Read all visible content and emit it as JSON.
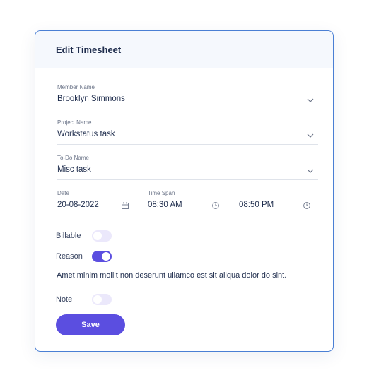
{
  "dialog": {
    "title": "Edit Timesheet",
    "member": {
      "label": "Member Name",
      "value": "Brooklyn Simmons"
    },
    "project": {
      "label": "Project Name",
      "value": "Workstatus task"
    },
    "todo": {
      "label": "To-Do Name",
      "value": "Misc task"
    },
    "date": {
      "label": "Date",
      "value": "20-08-2022"
    },
    "time_span": {
      "label": "Time Span",
      "start": "08:30 AM",
      "end": "08:50 PM"
    },
    "billable": {
      "label": "Billable",
      "enabled": false
    },
    "reason": {
      "label": "Reason",
      "enabled": true,
      "text": "Amet minim mollit non deserunt ullamco est sit aliqua dolor do sint."
    },
    "note": {
      "label": "Note",
      "enabled": false
    },
    "save_label": "Save"
  },
  "colors": {
    "accent": "#5b4ee0",
    "border": "#4a7fd4",
    "header_bg": "#f5f8fd"
  }
}
